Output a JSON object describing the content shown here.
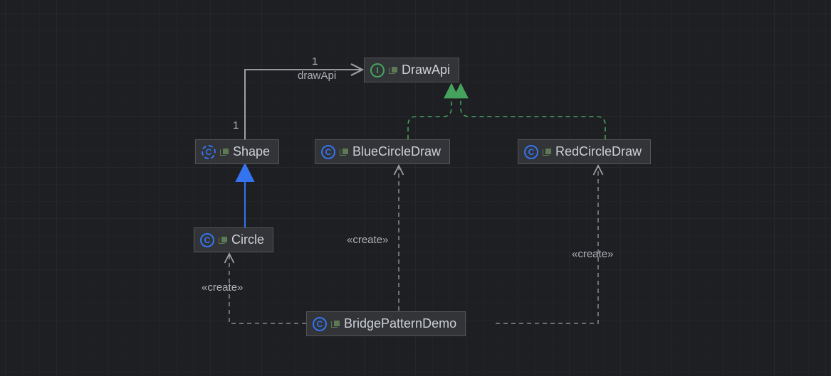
{
  "nodes": {
    "drawApi": {
      "name": "DrawApi",
      "kind": "interface"
    },
    "shape": {
      "name": "Shape",
      "kind": "abstract-class"
    },
    "blueCircle": {
      "name": "BlueCircleDraw",
      "kind": "class"
    },
    "redCircle": {
      "name": "RedCircleDraw",
      "kind": "class"
    },
    "circle": {
      "name": "Circle",
      "kind": "class"
    },
    "demo": {
      "name": "BridgePatternDemo",
      "kind": "class"
    }
  },
  "labels": {
    "mult_top": "1",
    "role_top": "drawApi",
    "mult_side": "1",
    "create1": "«create»",
    "create2": "«create»",
    "create3": "«create»"
  },
  "icon_letters": {
    "class": "C",
    "interface": "I",
    "abstract": "C"
  },
  "edges": [
    {
      "from": "Shape",
      "to": "DrawApi",
      "kind": "aggregation",
      "role": "drawApi",
      "multiplicities": [
        "1",
        "1"
      ]
    },
    {
      "from": "Circle",
      "to": "Shape",
      "kind": "generalization"
    },
    {
      "from": "BlueCircleDraw",
      "to": "DrawApi",
      "kind": "realization"
    },
    {
      "from": "RedCircleDraw",
      "to": "DrawApi",
      "kind": "realization"
    },
    {
      "from": "BridgePatternDemo",
      "to": "Circle",
      "kind": "dependency",
      "stereotype": "«create»"
    },
    {
      "from": "BridgePatternDemo",
      "to": "BlueCircleDraw",
      "kind": "dependency",
      "stereotype": "«create»"
    },
    {
      "from": "BridgePatternDemo",
      "to": "RedCircleDraw",
      "kind": "dependency",
      "stereotype": "«create»"
    }
  ]
}
